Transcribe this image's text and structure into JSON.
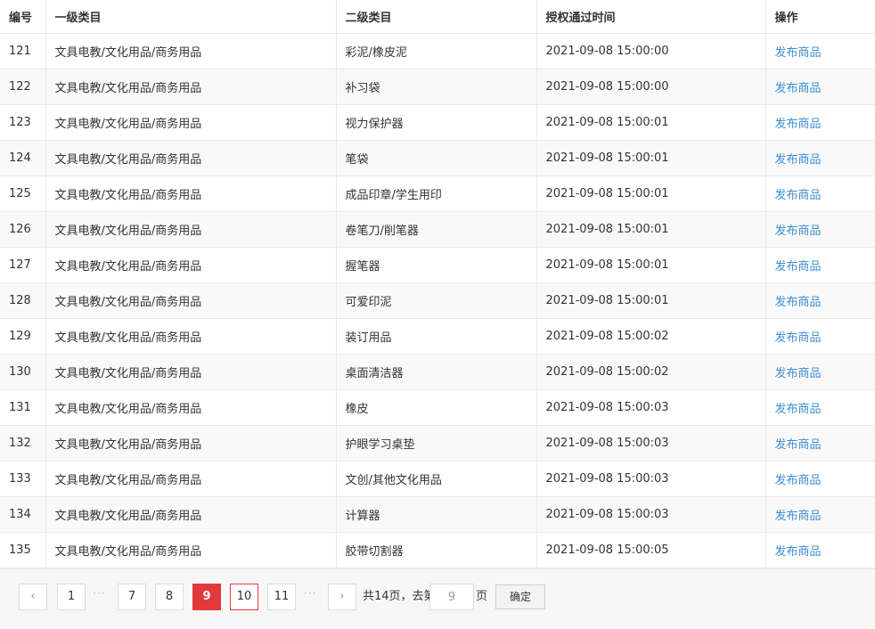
{
  "table": {
    "headers": {
      "id": "编号",
      "category_l1": "一级类目",
      "category_l2": "二级类目",
      "auth_time": "授权通过时间",
      "action": "操作"
    },
    "rows": [
      {
        "id": "121",
        "l1": "文具电教/文化用品/商务用品",
        "l2": "彩泥/橡皮泥",
        "time": "2021-09-08 15:00:00",
        "action": "发布商品"
      },
      {
        "id": "122",
        "l1": "文具电教/文化用品/商务用品",
        "l2": "补习袋",
        "time": "2021-09-08 15:00:00",
        "action": "发布商品"
      },
      {
        "id": "123",
        "l1": "文具电教/文化用品/商务用品",
        "l2": "视力保护器",
        "time": "2021-09-08 15:00:01",
        "action": "发布商品"
      },
      {
        "id": "124",
        "l1": "文具电教/文化用品/商务用品",
        "l2": "笔袋",
        "time": "2021-09-08 15:00:01",
        "action": "发布商品"
      },
      {
        "id": "125",
        "l1": "文具电教/文化用品/商务用品",
        "l2": "成品印章/学生用印",
        "time": "2021-09-08 15:00:01",
        "action": "发布商品"
      },
      {
        "id": "126",
        "l1": "文具电教/文化用品/商务用品",
        "l2": "卷笔刀/削笔器",
        "time": "2021-09-08 15:00:01",
        "action": "发布商品"
      },
      {
        "id": "127",
        "l1": "文具电教/文化用品/商务用品",
        "l2": "握笔器",
        "time": "2021-09-08 15:00:01",
        "action": "发布商品"
      },
      {
        "id": "128",
        "l1": "文具电教/文化用品/商务用品",
        "l2": "可爱印泥",
        "time": "2021-09-08 15:00:01",
        "action": "发布商品"
      },
      {
        "id": "129",
        "l1": "文具电教/文化用品/商务用品",
        "l2": "装订用品",
        "time": "2021-09-08 15:00:02",
        "action": "发布商品"
      },
      {
        "id": "130",
        "l1": "文具电教/文化用品/商务用品",
        "l2": "桌面清洁器",
        "time": "2021-09-08 15:00:02",
        "action": "发布商品"
      },
      {
        "id": "131",
        "l1": "文具电教/文化用品/商务用品",
        "l2": "橡皮",
        "time": "2021-09-08 15:00:03",
        "action": "发布商品"
      },
      {
        "id": "132",
        "l1": "文具电教/文化用品/商务用品",
        "l2": "护眼学习桌垫",
        "time": "2021-09-08 15:00:03",
        "action": "发布商品"
      },
      {
        "id": "133",
        "l1": "文具电教/文化用品/商务用品",
        "l2": "文创/其他文化用品",
        "time": "2021-09-08 15:00:03",
        "action": "发布商品"
      },
      {
        "id": "134",
        "l1": "文具电教/文化用品/商务用品",
        "l2": "计算器",
        "time": "2021-09-08 15:00:03",
        "action": "发布商品"
      },
      {
        "id": "135",
        "l1": "文具电教/文化用品/商务用品",
        "l2": "胶带切割器",
        "time": "2021-09-08 15:00:05",
        "action": "发布商品"
      }
    ]
  },
  "pagination": {
    "prev_icon": "chevron-left-icon",
    "next_icon": "chevron-right-icon",
    "prev_glyph": "‹",
    "next_glyph": "›",
    "ellipsis": "···",
    "pages": [
      "1",
      "7",
      "8",
      "9",
      "10",
      "11"
    ],
    "current_page": "9",
    "total_text": "共14页，去第",
    "goto_value": "9",
    "page_suffix": "页",
    "confirm_label": "确定",
    "active_color": "#e4393c",
    "link_color": "#3b8ed4"
  }
}
